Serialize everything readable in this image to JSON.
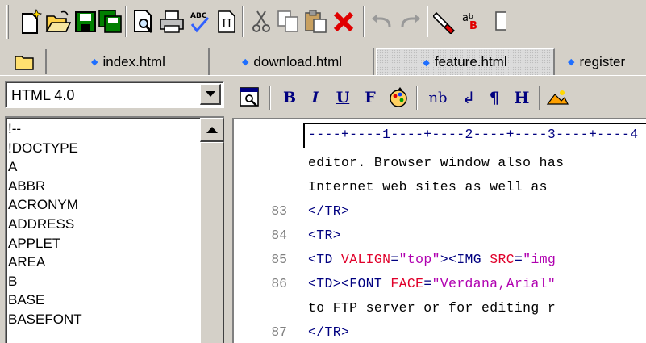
{
  "main_toolbar": {
    "icons": [
      "new-file",
      "open-folder",
      "save",
      "save-all",
      "print-preview",
      "print",
      "spell-check",
      "html-document",
      "cut",
      "copy",
      "paste",
      "delete",
      "undo",
      "redo",
      "highlighter",
      "find-replace"
    ]
  },
  "tabs": [
    {
      "label": "index.html",
      "active": false
    },
    {
      "label": "download.html",
      "active": false
    },
    {
      "label": "feature.html",
      "active": true
    },
    {
      "label": "register",
      "active": false
    }
  ],
  "doctype_select": {
    "value": "HTML 4.0"
  },
  "tag_list": [
    "!--",
    "!DOCTYPE",
    "A",
    "ABBR",
    "ACRONYM",
    "ADDRESS",
    "APPLET",
    "AREA",
    "B",
    "BASE",
    "BASEFONT"
  ],
  "format_toolbar": {
    "bold_label": "B",
    "italic_label": "I",
    "underline_label": "U",
    "font_label": "F",
    "nbsp_label": "nb",
    "linebreak_label": "↲",
    "paragraph_label": "¶",
    "heading_label": "H"
  },
  "editor": {
    "ruler": "----+----1----+----2----+----3----+----4",
    "lines": [
      {
        "number": "",
        "text": "editor. Browser window also has"
      },
      {
        "number": "",
        "text": "Internet web sites as well as"
      },
      {
        "number": "83",
        "text": "</TR>"
      },
      {
        "number": "84",
        "text": "<TR>"
      },
      {
        "number": "85",
        "text": "<TD VALIGN=\"top\"><IMG SRC=\"img"
      },
      {
        "number": "86",
        "text": "<TD><FONT FACE=\"Verdana,Arial\""
      },
      {
        "number": "",
        "text": "to FTP server or for editing r"
      },
      {
        "number": "87",
        "text": "</TR>"
      }
    ],
    "colors": {
      "tag": "#000080",
      "attribute": "#e0002a",
      "string": "#b000b0",
      "line_number": "#808080"
    }
  }
}
